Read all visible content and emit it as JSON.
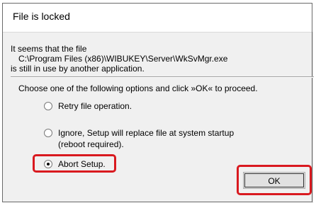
{
  "dialog": {
    "title": "File is locked"
  },
  "message": {
    "line1": "It seems that the file",
    "path": "C:\\Program Files (x86)\\WIBUKEY\\Server\\WkSvMgr.exe",
    "line3": "is still in use by another application.",
    "instruction": "Choose one of the following options and click »OK« to proceed."
  },
  "options": [
    {
      "label": "Retry file operation.",
      "selected": false
    },
    {
      "label_line1": "Ignore, Setup will replace file at system startup",
      "label_line2": "(reboot required).",
      "selected": false
    },
    {
      "label": "Abort Setup.",
      "selected": true
    }
  ],
  "buttons": {
    "ok_label": "OK"
  },
  "colors": {
    "highlight": "#d9191f",
    "dialog_bg": "#f0f0f0"
  }
}
